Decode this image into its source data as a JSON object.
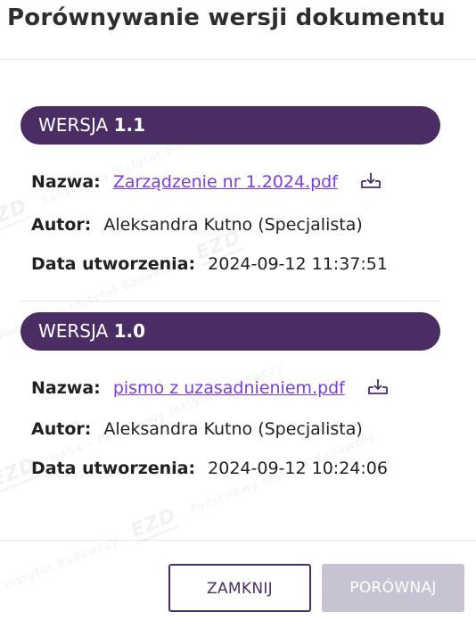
{
  "dialog": {
    "title": "Porównywanie wersji dokumentu"
  },
  "watermark": {
    "logo": "EZD",
    "text1": "NASK – Państwowy Instytut Badawczy",
    "text2": "Państwowy Instytut Badawczy"
  },
  "versions": [
    {
      "label_prefix": "WERSJA",
      "number": "1.1",
      "name_label": "Nazwa:",
      "file_name": "Zarządzenie nr 1.2024.pdf",
      "author_label": "Autor:",
      "author": "Aleksandra Kutno (Specjalista)",
      "date_label": "Data utworzenia:",
      "date": "2024-09-12 11:37:51"
    },
    {
      "label_prefix": "WERSJA",
      "number": "1.0",
      "name_label": "Nazwa:",
      "file_name": "pismo z uzasadnieniem.pdf",
      "author_label": "Autor:",
      "author": "Aleksandra Kutno (Specjalista)",
      "date_label": "Data utworzenia:",
      "date": "2024-09-12 10:24:06"
    }
  ],
  "footer": {
    "close_label": "ZAMKNIJ",
    "compare_label": "PORÓWNAJ"
  },
  "colors": {
    "accent": "#4a2d63",
    "link": "#7b3fd6",
    "disabled_button": "#c8c3d2"
  },
  "icons": {
    "download": "download-icon"
  }
}
